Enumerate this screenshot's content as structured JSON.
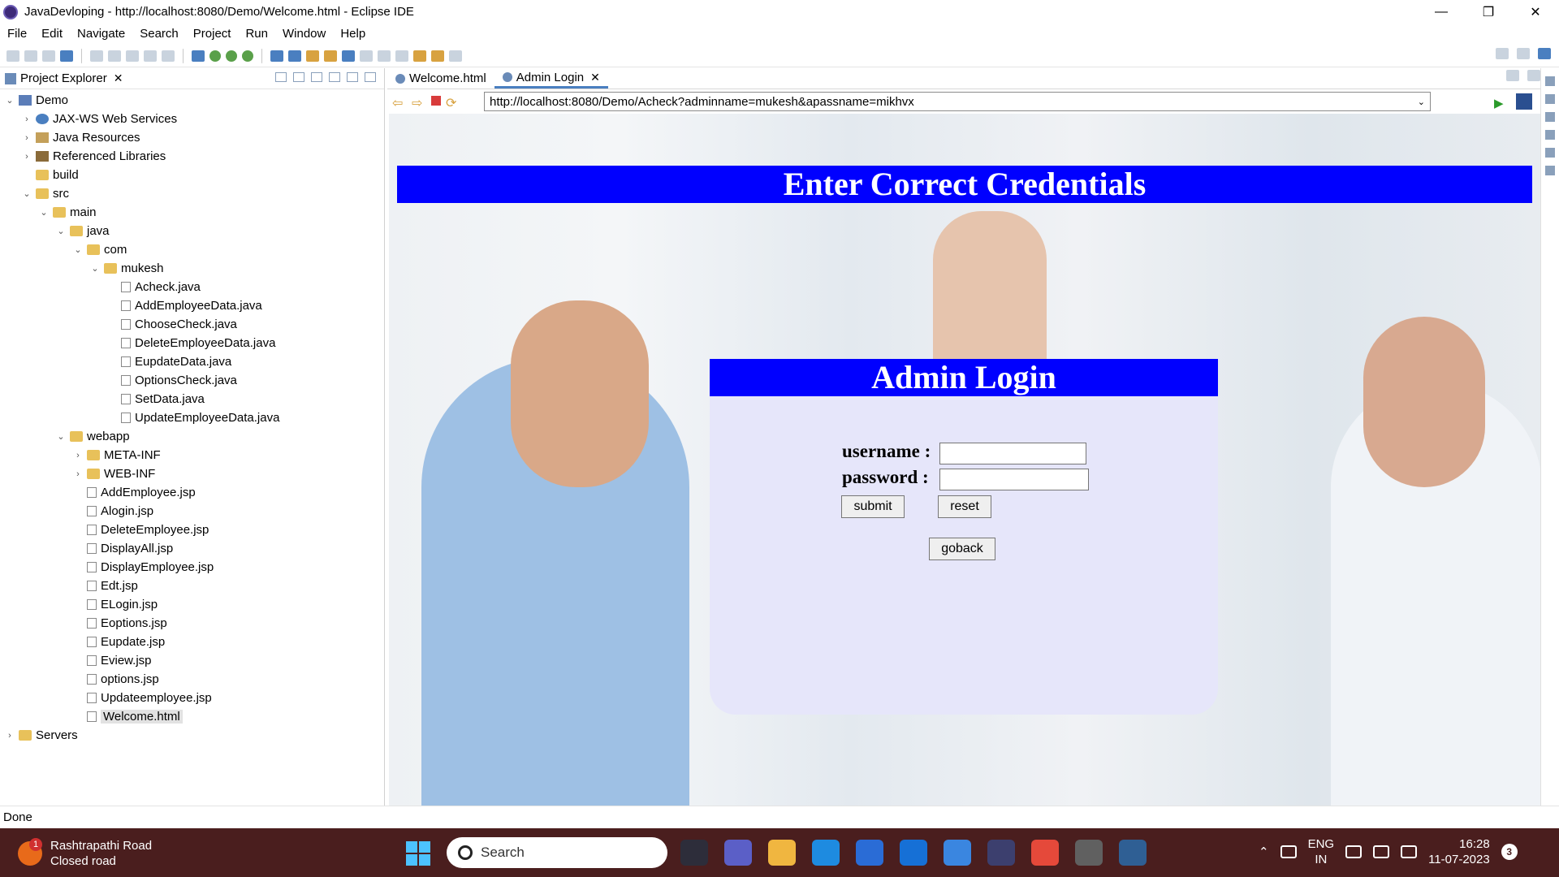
{
  "window": {
    "title": "JavaDevloping - http://localhost:8080/Demo/Welcome.html - Eclipse IDE",
    "minimize": "—",
    "restore": "❐",
    "close": "✕"
  },
  "menu": [
    "File",
    "Edit",
    "Navigate",
    "Search",
    "Project",
    "Run",
    "Window",
    "Help"
  ],
  "project_explorer": {
    "title": "Project Explorer",
    "close": "✕",
    "tree": [
      {
        "label": "Demo",
        "depth": 0,
        "twisty": "⌄",
        "icon": "project-icon"
      },
      {
        "label": "JAX-WS Web Services",
        "depth": 1,
        "twisty": "›",
        "icon": "webservice-icon"
      },
      {
        "label": "Java Resources",
        "depth": 1,
        "twisty": "›",
        "icon": "java-resources-icon"
      },
      {
        "label": "Referenced Libraries",
        "depth": 1,
        "twisty": "›",
        "icon": "library-icon"
      },
      {
        "label": "build",
        "depth": 1,
        "twisty": "",
        "icon": "folder-icon"
      },
      {
        "label": "src",
        "depth": 1,
        "twisty": "⌄",
        "icon": "folder-icon"
      },
      {
        "label": "main",
        "depth": 2,
        "twisty": "⌄",
        "icon": "folder-icon"
      },
      {
        "label": "java",
        "depth": 3,
        "twisty": "⌄",
        "icon": "folder-icon"
      },
      {
        "label": "com",
        "depth": 4,
        "twisty": "⌄",
        "icon": "folder-icon"
      },
      {
        "label": "mukesh",
        "depth": 5,
        "twisty": "⌄",
        "icon": "folder-icon"
      },
      {
        "label": "Acheck.java",
        "depth": 6,
        "twisty": "",
        "icon": "java-file-icon"
      },
      {
        "label": "AddEmployeeData.java",
        "depth": 6,
        "twisty": "",
        "icon": "java-file-icon"
      },
      {
        "label": "ChooseCheck.java",
        "depth": 6,
        "twisty": "",
        "icon": "java-file-icon"
      },
      {
        "label": "DeleteEmployeeData.java",
        "depth": 6,
        "twisty": "",
        "icon": "java-file-icon"
      },
      {
        "label": "EupdateData.java",
        "depth": 6,
        "twisty": "",
        "icon": "java-file-icon"
      },
      {
        "label": "OptionsCheck.java",
        "depth": 6,
        "twisty": "",
        "icon": "java-file-icon"
      },
      {
        "label": "SetData.java",
        "depth": 6,
        "twisty": "",
        "icon": "java-file-icon"
      },
      {
        "label": "UpdateEmployeeData.java",
        "depth": 6,
        "twisty": "",
        "icon": "java-file-icon"
      },
      {
        "label": "webapp",
        "depth": 3,
        "twisty": "⌄",
        "icon": "folder-icon"
      },
      {
        "label": "META-INF",
        "depth": 4,
        "twisty": "›",
        "icon": "folder-icon"
      },
      {
        "label": "WEB-INF",
        "depth": 4,
        "twisty": "›",
        "icon": "folder-icon"
      },
      {
        "label": "AddEmployee.jsp",
        "depth": 4,
        "twisty": "",
        "icon": "jsp-file-icon"
      },
      {
        "label": "Alogin.jsp",
        "depth": 4,
        "twisty": "",
        "icon": "jsp-file-icon"
      },
      {
        "label": "DeleteEmployee.jsp",
        "depth": 4,
        "twisty": "",
        "icon": "jsp-file-icon"
      },
      {
        "label": "DisplayAll.jsp",
        "depth": 4,
        "twisty": "",
        "icon": "jsp-file-icon"
      },
      {
        "label": "DisplayEmployee.jsp",
        "depth": 4,
        "twisty": "",
        "icon": "jsp-file-icon"
      },
      {
        "label": "Edt.jsp",
        "depth": 4,
        "twisty": "",
        "icon": "jsp-file-icon"
      },
      {
        "label": "ELogin.jsp",
        "depth": 4,
        "twisty": "",
        "icon": "jsp-file-icon"
      },
      {
        "label": "Eoptions.jsp",
        "depth": 4,
        "twisty": "",
        "icon": "jsp-file-icon"
      },
      {
        "label": "Eupdate.jsp",
        "depth": 4,
        "twisty": "",
        "icon": "jsp-file-icon"
      },
      {
        "label": "Eview.jsp",
        "depth": 4,
        "twisty": "",
        "icon": "jsp-file-icon"
      },
      {
        "label": "options.jsp",
        "depth": 4,
        "twisty": "",
        "icon": "jsp-file-icon"
      },
      {
        "label": "Updateemployee.jsp",
        "depth": 4,
        "twisty": "",
        "icon": "jsp-file-icon"
      },
      {
        "label": "Welcome.html",
        "depth": 4,
        "twisty": "",
        "icon": "html-file-icon",
        "selected": true
      },
      {
        "label": "Servers",
        "depth": 0,
        "twisty": "›",
        "icon": "folder-icon"
      }
    ]
  },
  "editor": {
    "tabs": [
      {
        "label": "Welcome.html",
        "active": false
      },
      {
        "label": "Admin Login",
        "active": true,
        "close": "✕"
      }
    ],
    "url": "http://localhost:8080/Demo/Acheck?adminname=mukesh&apassname=mikhvx",
    "dropdown_glyph": "⌄",
    "go_glyph": "▶"
  },
  "page": {
    "banner": "Enter Correct Credentials",
    "login_title": "Admin Login",
    "username_label": "username :",
    "password_label": "password :",
    "username_value": "",
    "password_value": "",
    "submit": "submit",
    "reset": "reset",
    "goback": "goback"
  },
  "status": "Done",
  "taskbar": {
    "weather_badge": "1",
    "weather_line1": "Rashtrapathi Road",
    "weather_line2": "Closed road",
    "search_placeholder": "Search",
    "lang_top": "ENG",
    "lang_bottom": "IN",
    "time": "16:28",
    "date": "11-07-2023",
    "notification_count": "3",
    "app_colors": [
      "#2d2d3a",
      "#5b5fc7",
      "#f0b640",
      "#1e8be0",
      "#2a6cd6",
      "#1670d6",
      "#3a86e0",
      "#3c3f6e",
      "#e5493a",
      "#606060",
      "#2f5f94"
    ]
  }
}
